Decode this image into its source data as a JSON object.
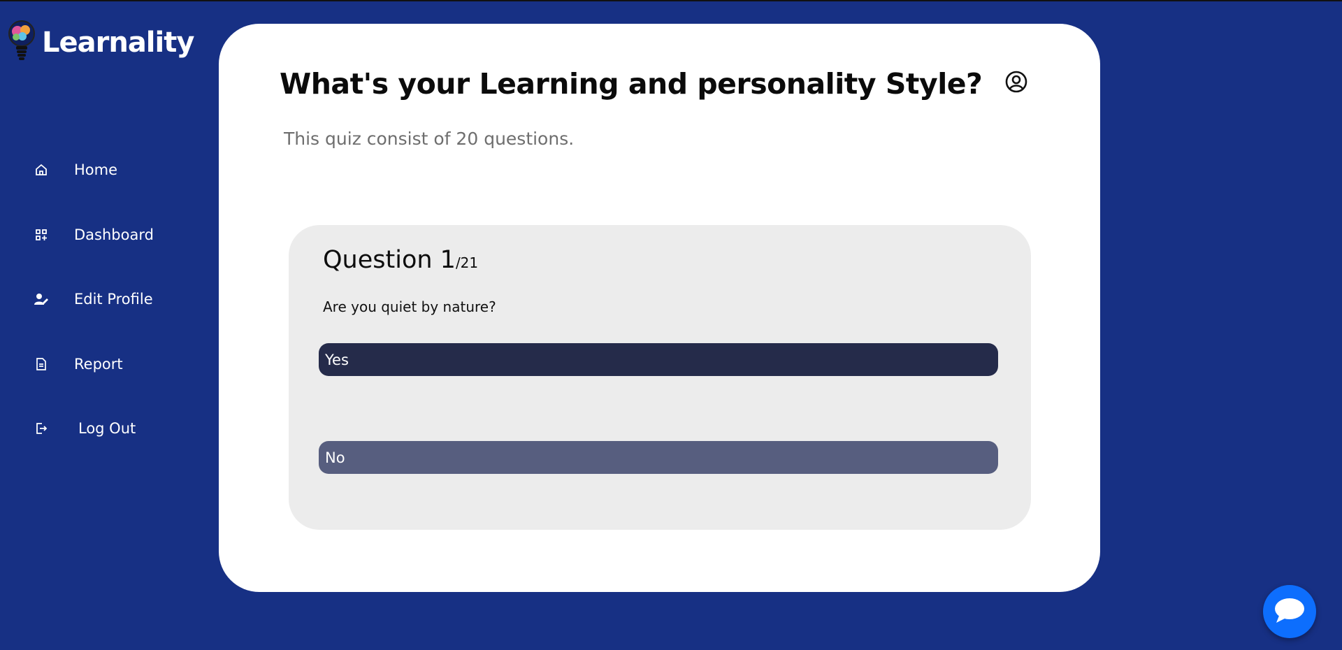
{
  "brand": {
    "name": "Learnality",
    "logo_icon": "lightbulb-brain-icon"
  },
  "sidebar": {
    "items": [
      {
        "label": "Home",
        "icon": "home-icon"
      },
      {
        "label": "Dashboard",
        "icon": "grid-plus-icon"
      },
      {
        "label": "Edit Profile",
        "icon": "user-edit-icon"
      },
      {
        "label": "Report",
        "icon": "document-icon"
      },
      {
        "label": "Log Out",
        "icon": "logout-icon"
      }
    ]
  },
  "main": {
    "title": "What's your Learning and personality Style?",
    "subtitle": "This quiz consist of 20 questions.",
    "profile_icon": "user-circle-icon"
  },
  "question": {
    "label": "Question 1",
    "total": "/21",
    "text": "Are you quiet by nature?",
    "options": [
      "Yes",
      "No"
    ]
  },
  "chat": {
    "icon": "chat-bubble-icon"
  },
  "colors": {
    "background": "#173084",
    "card": "#ffffff",
    "question_box": "#ececec",
    "option_selected": "#252b4a",
    "option_default": "#575e7f",
    "chat_button": "#0d6efd"
  }
}
